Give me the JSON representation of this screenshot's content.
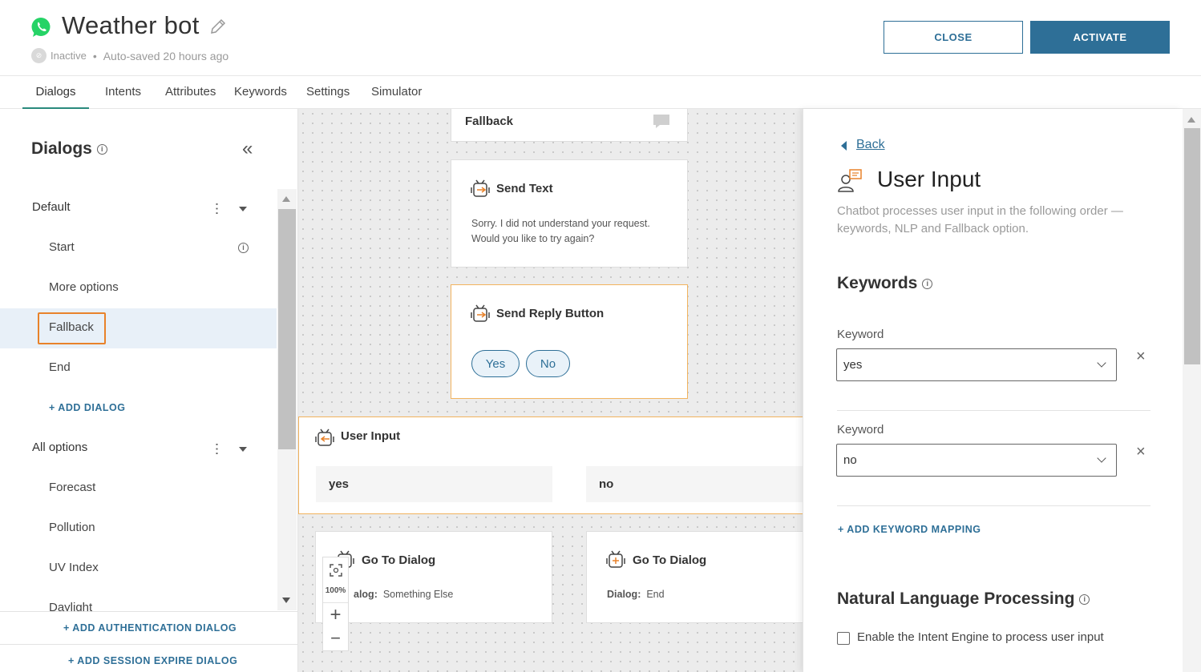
{
  "header": {
    "title": "Weather bot",
    "status": "Inactive",
    "autosave": "Auto-saved 20 hours ago",
    "close_label": "CLOSE",
    "activate_label": "ACTIVATE",
    "status_dot_glyph": "⊘"
  },
  "tabs": [
    "Dialogs",
    "Intents",
    "Attributes",
    "Keywords",
    "Settings",
    "Simulator"
  ],
  "sidebar": {
    "title": "Dialogs",
    "groups": [
      {
        "name": "Default",
        "items": [
          "Start",
          "More options",
          "Fallback",
          "End"
        ],
        "add_label": "+ ADD DIALOG"
      },
      {
        "name": "All options",
        "items": [
          "Forecast",
          "Pollution",
          "UV Index",
          "Daylight"
        ]
      }
    ],
    "add_auth": "+ ADD AUTHENTICATION DIALOG",
    "add_session": "+ ADD SESSION EXPIRE DIALOG",
    "selected_item": "Fallback",
    "collapse_glyph": "«"
  },
  "canvas": {
    "fallback_card": "Fallback",
    "send_text": {
      "title": "Send Text",
      "line1": "Sorry. I did not understand your request.",
      "line2": "Would you like to try again?"
    },
    "send_reply": {
      "title": "Send Reply Button",
      "buttons": [
        "Yes",
        "No"
      ]
    },
    "user_input": {
      "title": "User Input",
      "keywords": [
        "yes",
        "no"
      ]
    },
    "goto1": {
      "title": "Go To Dialog",
      "label_visible": "alog:",
      "value": "Something Else"
    },
    "goto2": {
      "title": "Go To Dialog",
      "label": "Dialog:",
      "value": "End"
    },
    "zoom": "100%",
    "zoom_in": "+",
    "zoom_out": "−"
  },
  "panel": {
    "back": "Back",
    "title": "User Input",
    "desc": "Chatbot processes user input in the following order — keywords, NLP and Fallback option.",
    "keywords_title": "Keywords",
    "keyword_label": "Keyword",
    "keyword_values": [
      "yes",
      "no"
    ],
    "remove_glyph": "×",
    "add_mapping": "+ ADD KEYWORD MAPPING",
    "nlp_title": "Natural Language Processing",
    "nlp_checkbox_label": "Enable the Intent Engine to process user input"
  },
  "colors": {
    "accent": "#2e6f97",
    "highlight": "#e8822a",
    "whatsapp": "#25d366",
    "tab_underline": "#2a8a7d"
  }
}
